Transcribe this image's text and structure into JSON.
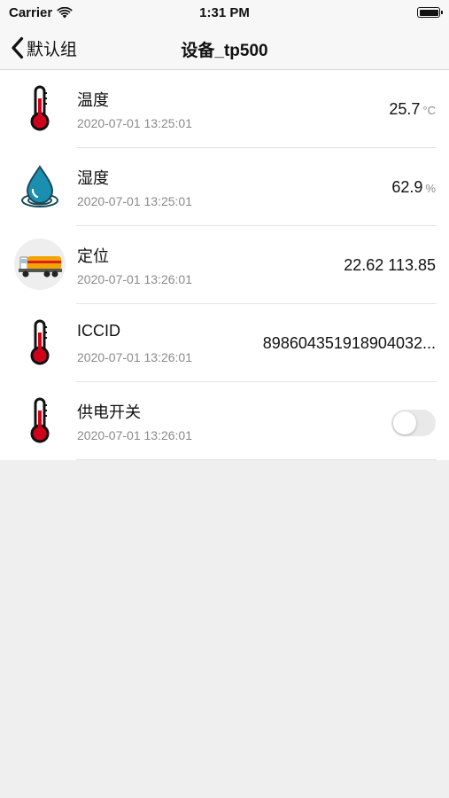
{
  "status_bar": {
    "carrier": "Carrier",
    "time": "1:31 PM",
    "wifi_icon": "wifi-icon",
    "battery_icon": "battery-icon"
  },
  "nav": {
    "back_icon": "chevron-left-icon",
    "back_label": "默认组",
    "title": "设备_tp500"
  },
  "rows": [
    {
      "icon": "thermometer-icon",
      "name": "温度",
      "time": "2020-07-01 13:25:01",
      "value": "25.7",
      "unit": "°C"
    },
    {
      "icon": "water-drop-icon",
      "name": "湿度",
      "time": "2020-07-01 13:25:01",
      "value": "62.9",
      "unit": "%"
    },
    {
      "icon": "truck-icon",
      "name": "定位",
      "time": "2020-07-01 13:26:01",
      "value": "22.62 113.85",
      "unit": ""
    },
    {
      "icon": "thermometer-icon",
      "name": "ICCID",
      "time": "2020-07-01 13:26:01",
      "value": "898604351918904032...",
      "unit": ""
    },
    {
      "icon": "thermometer-icon",
      "name": "供电开关",
      "time": "2020-07-01 13:26:01",
      "toggle_on": false
    }
  ],
  "colors": {
    "thermo_red": "#d0021b",
    "drop_blue": "#1b8fb0",
    "toggle_off": "#e9e9ea"
  }
}
